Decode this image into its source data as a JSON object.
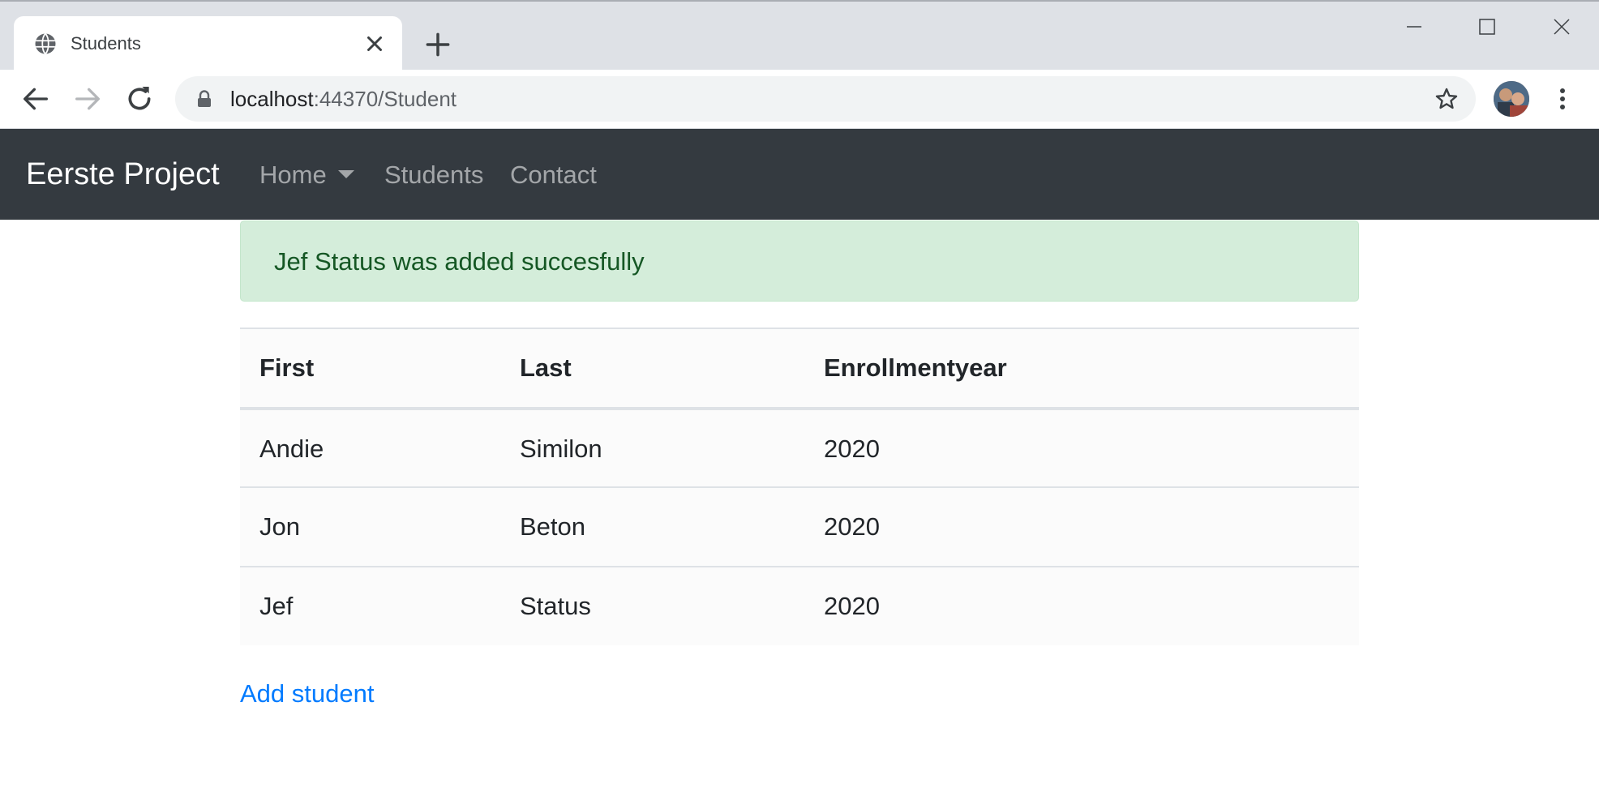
{
  "browser": {
    "tab_title": "Students",
    "url_host": "localhost",
    "url_rest": ":44370/Student"
  },
  "navbar": {
    "brand": "Eerste Project",
    "links": [
      {
        "label": "Home",
        "has_dropdown": true
      },
      {
        "label": "Students"
      },
      {
        "label": "Contact"
      }
    ]
  },
  "alert": {
    "message": "Jef Status was added succesfully",
    "color": "#d4edda"
  },
  "table": {
    "headers": [
      "First",
      "Last",
      "Enrollmentyear"
    ],
    "rows": [
      [
        "Andie",
        "Similon",
        "2020"
      ],
      [
        "Jon",
        "Beton",
        "2020"
      ],
      [
        "Jef",
        "Status",
        "2020"
      ]
    ]
  },
  "add_link": "Add student",
  "colors": {
    "navbar_bg": "#343a40",
    "link": "#007bff",
    "alert_text": "#155724"
  }
}
